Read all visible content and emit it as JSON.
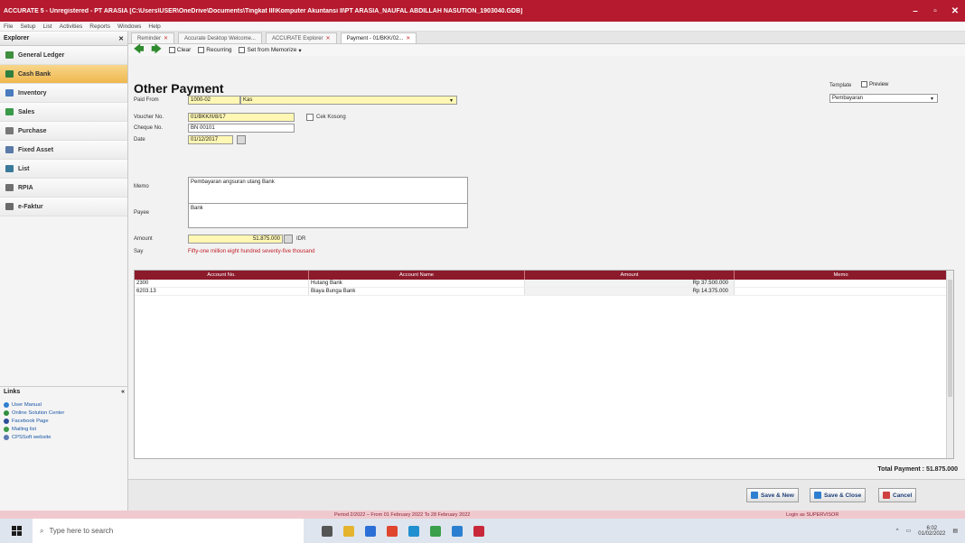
{
  "window": {
    "title": "ACCURATE 5 - Unregistered - PT ARASIA [C:\\Users\\USER\\OneDrive\\Documents\\Tingkat III\\Komputer Akuntansi II\\PT ARASIA_NAUFAL ABDILLAH NASUTION_1903040.GDB]",
    "minimize": "–",
    "maximize": "▫",
    "close": "✕"
  },
  "menu": [
    "File",
    "Setup",
    "List",
    "Activities",
    "Reports",
    "Windows",
    "Help"
  ],
  "explorer": {
    "title": "Explorer",
    "close": "✕",
    "items": [
      {
        "label": "General Ledger",
        "icon": "general-ledger-icon",
        "color": "#3f8f3f"
      },
      {
        "label": "Cash Bank",
        "icon": "cash-bank-icon",
        "color": "#2f7f3f",
        "active": true
      },
      {
        "label": "Inventory",
        "icon": "inventory-icon",
        "color": "#4a7bbf"
      },
      {
        "label": "Sales",
        "icon": "sales-icon",
        "color": "#3a9a4a"
      },
      {
        "label": "Purchase",
        "icon": "purchase-icon",
        "color": "#777777"
      },
      {
        "label": "Fixed Asset",
        "icon": "fixed-asset-icon",
        "color": "#5a7aa8"
      },
      {
        "label": "List",
        "icon": "list-icon",
        "color": "#3a7a9a"
      },
      {
        "label": "RPIA",
        "icon": "rpia-icon",
        "color": "#6f6f6f"
      },
      {
        "label": "e-Faktur",
        "icon": "efaktur-icon",
        "color": "#6a6a6a"
      }
    ]
  },
  "links": {
    "title": "Links",
    "collapse": "«",
    "items": [
      {
        "label": "User Manual",
        "color": "#2f7fd0"
      },
      {
        "label": "Online Solution Center",
        "color": "#2f8f3f"
      },
      {
        "label": "Facebook Page",
        "color": "#2d4f9a"
      },
      {
        "label": "Mailing list",
        "color": "#3a9a4a"
      },
      {
        "label": "CPSSoft website",
        "color": "#5a7ab0"
      }
    ]
  },
  "tabs": [
    {
      "label": "Reminder"
    },
    {
      "label": "Accurate Desktop Welcome..."
    },
    {
      "label": "ACCURATE Explorer"
    },
    {
      "label": "Payment - 01/BKK/02...",
      "active": true
    }
  ],
  "toolbar": {
    "back": "🡄",
    "forward": "🡆",
    "clear": "Clear",
    "recurring": "Recurring",
    "set_memorize": "Set from Memorize"
  },
  "form": {
    "title": "Other Payment",
    "paid_from_label": "Paid From",
    "paid_from_code": "1000-02",
    "paid_from_name": "Kas",
    "voucher_label": "Voucher No.",
    "voucher_value": "01/BKK/II/8/17",
    "void_cheque_label": "Cek Kosong",
    "cheque_label": "Cheque No.",
    "cheque_value": "BN 00101",
    "date_label": "Date",
    "date_value": "01/12/2017",
    "memo_label": "Memo",
    "memo_value": "Pembayaran angsuran utang Bank",
    "payee_label": "Payee",
    "payee_value": "Bank",
    "amount_label": "Amount",
    "amount_value": "51.875.000",
    "currency": "IDR",
    "say_label": "Say",
    "say_value": "Fifty-one million eight hundred seventy-five thousand",
    "template_label": "Template",
    "template_value": "Pembayaran",
    "preview_label": "Preview"
  },
  "grid": {
    "headers": [
      "Account No.",
      "Account Name",
      "Amount",
      "Memo"
    ],
    "rows": [
      {
        "account_no": "2300",
        "account_name": "Hutang Bank",
        "amount": "Rp 37.500.000",
        "memo": ""
      },
      {
        "account_no": "6203.13",
        "account_name": "Biaya Bunga Bank",
        "amount": "Rp 14.375.000",
        "memo": ""
      }
    ],
    "total_label": "Total Payment : 51.875.000"
  },
  "actions": {
    "save_new": "Save & New",
    "save_close": "Save & Close",
    "cancel": "Cancel"
  },
  "status": {
    "period": "Period 2/2022 – From 01 February 2022 To 28 February 2022",
    "login": "Login as SUPERVISOR"
  },
  "taskbar": {
    "search_placeholder": "Type here to search",
    "time": "6:02",
    "date": "01/02/2022"
  }
}
